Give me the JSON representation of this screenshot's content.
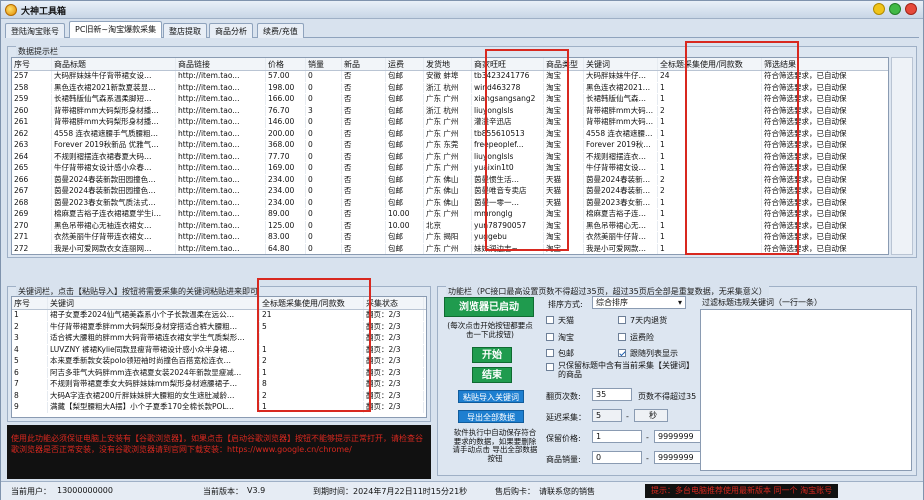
{
  "window": {
    "title": "大神工具箱"
  },
  "tabs": [
    "登陆淘宝账号",
    "PC旧新~淘宝爆款采集",
    "整店提取",
    "商品分析",
    "续费/充值"
  ],
  "active_tab": 1,
  "data_panel": {
    "title": "数据提示栏",
    "columns": [
      "序号",
      "商品标题",
      "商品链接",
      "价格",
      "销量",
      "新品",
      "运费",
      "发货地",
      "商家旺旺",
      "商品类型",
      "关键词",
      "全标题采集使用/同款数",
      "筛选结果"
    ],
    "rows": [
      [
        "257",
        "大码胖妹妹牛仔背带裙女设…",
        "http://item.tao...",
        "57.00",
        "0",
        "否",
        "包邮",
        "安徽 蚌埠",
        "tb3423241776",
        "淘宝",
        "大码胖妹妹牛仔…",
        "24",
        "符合筛选要求，已自动保"
      ],
      [
        "258",
        "黑色连衣裙2021新款夏装显…",
        "http://item.tao...",
        "198.00",
        "0",
        "否",
        "包邮",
        "浙江 杭州",
        "wind463278",
        "淘宝",
        "黑色连衣裙2021…",
        "1",
        "符合筛选要求，已自动保"
      ],
      [
        "259",
        "长裙韩版仙气森系温柔脚短…",
        "http://item.tao...",
        "166.00",
        "0",
        "否",
        "包邮",
        "广东 广州",
        "xiangsangsang2",
        "淘宝",
        "长裙韩版仙气森…",
        "1",
        "符合筛选要求，已自动保"
      ],
      [
        "260",
        "背带裙胖mm大码梨形身材播…",
        "http://item.tao...",
        "76.70",
        "3",
        "否",
        "包邮",
        "浙江 杭州",
        "liuyonglsls",
        "淘宝",
        "背带裙胖mm大码…",
        "2",
        "符合筛选要求，已自动保"
      ],
      [
        "261",
        "背带裙胖mm大码梨形身材播…",
        "http://item.tao...",
        "146.00",
        "0",
        "否",
        "包邮",
        "广东 广州",
        "灌溢辛迅店",
        "淘宝",
        "背带裙胖mm大码…",
        "1",
        "符合筛选要求，已自动保"
      ],
      [
        "262",
        "4558 连衣裙遮腰手气质腰粗…",
        "http://item.tao...",
        "200.00",
        "0",
        "否",
        "包邮",
        "广东 广州",
        "tb855610513",
        "淘宝",
        "4558 连衣裙遮腰…",
        "1",
        "符合筛选要求，已自动保"
      ],
      [
        "263",
        "Forever 2019秋新品 优雅气…",
        "http://item.tao...",
        "368.00",
        "0",
        "否",
        "包邮",
        "广东 东莞",
        "freepeoplef...",
        "淘宝",
        "Forever 2019秋…",
        "1",
        "符合筛选要求，已自动保"
      ],
      [
        "264",
        "不规则褶摆连衣裙春夏大码…",
        "http://item.tao...",
        "77.70",
        "0",
        "否",
        "包邮",
        "广东 广州",
        "liuyonglsls",
        "淘宝",
        "不规则褶摆连衣…",
        "1",
        "符合筛选要求，已自动保"
      ],
      [
        "265",
        "牛仔背带裙女设计感小众春…",
        "http://item.tao...",
        "169.00",
        "0",
        "否",
        "包邮",
        "广东 广州",
        "yuaixin1t0",
        "淘宝",
        "牛仔背带裙女设…",
        "1",
        "符合筛选要求，已自动保"
      ],
      [
        "266",
        "茵曼2024春装新款田园撞色…",
        "http://item.tao...",
        "234.00",
        "0",
        "否",
        "包邮",
        "广东 佛山",
        "茵曼惯生活…",
        "天猫",
        "茵曼2024春装新…",
        "2",
        "符合筛选要求，已自动保"
      ],
      [
        "267",
        "茵曼2024春装新款田园撞色…",
        "http://item.tao...",
        "234.00",
        "0",
        "否",
        "包邮",
        "广东 佛山",
        "茵曼唯音专卖店",
        "天猫",
        "茵曼2024春装新…",
        "2",
        "符合筛选要求，已自动保"
      ],
      [
        "268",
        "茵曼2023春女新款气质法式…",
        "http://item.tao...",
        "234.00",
        "0",
        "否",
        "包邮",
        "广东 佛山",
        "茵曼一零一…",
        "天猫",
        "茵曼2023春女新…",
        "1",
        "符合筛选要求，已自动保"
      ],
      [
        "269",
        "棉麻夏吉裕子连衣裙裙夏学生i…",
        "http://item.tao...",
        "89.00",
        "0",
        "否",
        "10.00",
        "广东 广州",
        "mmronglg",
        "淘宝",
        "棉麻夏吉裕子连…",
        "1",
        "符合筛选要求，已自动保"
      ],
      [
        "270",
        "黑色吊带裙心无袖连衣裙女…",
        "http://item.tao...",
        "125.00",
        "0",
        "否",
        "10.00",
        "北京",
        "yun78790057",
        "淘宝",
        "黑色吊带裙心无…",
        "1",
        "符合筛选要求，已自动保"
      ],
      [
        "271",
        "衣然美丽牛仔背带连衣裙女…",
        "http://item.tao...",
        "83.00",
        "0",
        "否",
        "包邮",
        "广东 揭阳",
        "yuggebu",
        "淘宝",
        "衣然美丽牛仔背…",
        "1",
        "符合筛选要求，已自动保"
      ],
      [
        "272",
        "我是小可爱网款衣女连丽网…",
        "http://item.tao...",
        "64.80",
        "0",
        "否",
        "包邮",
        "广东 广州",
        "妹妹润边志~",
        "淘宝",
        "我是小可爱网款…",
        "1",
        "符合筛选要求，已自动保"
      ]
    ]
  },
  "keyword_panel": {
    "title": "关键词栏，点击【粘贴导入】按钮将需要采集的关键词粘贴进来即可",
    "columns": [
      "序号",
      "关键词",
      "全标题采集使用/同款数",
      "采集状态"
    ],
    "rows": [
      [
        "1",
        "裙子女夏季2024仙气裙美森系小个子长款温柔在远公…",
        "21",
        "翻页：2/3"
      ],
      [
        "2",
        "牛仔背带裙夏季胖mm大码梨形身材穿搭适合裤大腰粗…",
        "5",
        "翻页：2/3"
      ],
      [
        "3",
        "适合裤大腰粗的胖mm大码背带裙连衣裙女学生气质梨形…",
        "",
        "翻页：2/3"
      ],
      [
        "4",
        "LUVZNY 裤裙Kylie同款显瘦背带裙设计感小众半身裙…",
        "1",
        "翻页：2/3"
      ],
      [
        "5",
        "本来夏季新款女装polo领短袖时尚撞色百搭宽松连衣…",
        "2",
        "翻页：2/3"
      ],
      [
        "6",
        "阿吉多菲气大码胖mm连衣裙夏女装2024年新款显瘦减…",
        "1",
        "翻页：2/3"
      ],
      [
        "7",
        "不规则背带裙夏季女大码胖妹妹mm梨形身材遮腰裙子…",
        "8",
        "翻页：2/3"
      ],
      [
        "8",
        "大码A字连衣裙200斤胖妹妹胖大腰粗的女生遮肚减龄…",
        "2",
        "翻页：2/3"
      ],
      [
        "9",
        "满藏【梨型腰粗大A摆】小个子夏季170全棉长款POL…",
        "1",
        "翻页：2/3"
      ]
    ]
  },
  "function_panel": {
    "title": "功能栏（PC接口最高设置页数不得超过35页，超过35页后全部是重复数据，无采集意义）",
    "browser_button": "浏览器已启动",
    "browser_hint": "(每次点击开始按钮都要点击一下此按钮)",
    "start_button": "开始",
    "stop_button": "结束",
    "paste_button": "粘贴导入关键词",
    "export_button": "导出全部数据",
    "export_hint": "软件执行中自动保存符合要求的数据，如果要删除 请手动点击 导出全部数据 按钮",
    "sort_label": "排序方式:",
    "sort_value": "综合排序",
    "checks": [
      {
        "label": "天猫",
        "checked": false
      },
      {
        "label": "7天内退货",
        "checked": false
      },
      {
        "label": "淘宝",
        "checked": false
      },
      {
        "label": "运费险",
        "checked": false
      },
      {
        "label": "包邮",
        "checked": false
      },
      {
        "label": "跟随列表显示",
        "checked": true
      }
    ],
    "dup_check": "只保留标题中含有当前采集【关键词】的商品",
    "pages_label": "翻页次数:",
    "pages_value": "35",
    "pages_hint": "页数不得超过35",
    "delay_label": "延迟采集：",
    "delay_from": "5",
    "delay_to": "",
    "delay_unit": "秒",
    "price_label": "保留价格:",
    "price_from": "1",
    "price_to": "9999999",
    "sales_label": "商品销量:",
    "sales_from": "0",
    "sales_to": "9999999",
    "filter_label": "过滤标题违规关键词（一行一条）"
  },
  "notice": "使用此功能必须保证电脑上安装有【谷歌浏览器】，如果点击【启动谷歌浏览器】按钮不能够提示正常打开，请检查谷歌浏览器是否正常安装，没有谷歌浏览器请到官网下载安装：https://www.google.cn/chrome/",
  "status": {
    "user_label": "当前用户：",
    "user_value": "13000000000",
    "version_label": "当前版本：",
    "version_value": "V3.9",
    "expire_label": "到期时间：",
    "expire_value": "2024年7月22日11时15分21秒",
    "service_label": "售后购卡：",
    "service_value": "请联系您的销售",
    "tip": "提示：多台电脑推荐使用最新版本 同一个 淘宝账号"
  }
}
